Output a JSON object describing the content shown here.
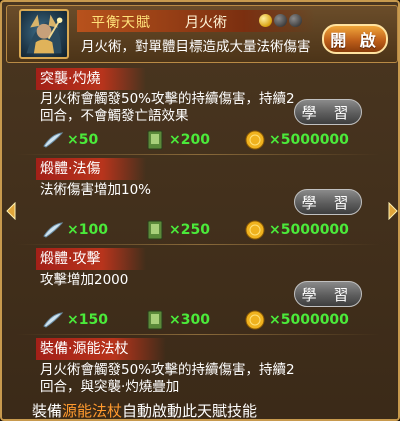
{
  "header": {
    "talent_type": "平衡天賦",
    "talent_name": "月火術",
    "description": "月火術，對單體目標造成大量法術傷害",
    "open_label": "開 啟",
    "level_dots": [
      "gold",
      "gray",
      "gray"
    ]
  },
  "entries": [
    {
      "title": "突襲·灼燒",
      "desc_lines": [
        "月火術會觸發50%攻擊的持續傷害，持續2",
        "回合，不會觸發亡語效果"
      ],
      "learn_label": "學 習",
      "costs": [
        "×50",
        "×200",
        "×5000000"
      ]
    },
    {
      "title": "煅體·法傷",
      "desc_lines": [
        "法術傷害增加10%"
      ],
      "learn_label": "學 習",
      "costs": [
        "×100",
        "×250",
        "×5000000"
      ]
    },
    {
      "title": "煅體·攻擊",
      "desc_lines": [
        "攻擊增加2000"
      ],
      "learn_label": "學 習",
      "costs": [
        "×150",
        "×300",
        "×5000000"
      ]
    },
    {
      "title": "裝備·源能法杖",
      "desc_lines": [
        "月火術會觸發50%攻擊的持續傷害，持續2",
        "回合，與突襲·灼燒疊加"
      ]
    }
  ],
  "footer": {
    "prefix": "裝備",
    "highlight": "源能法杖",
    "suffix": "自動啟動此天賦技能"
  },
  "colors": {
    "accent_orange": "#ff9a2e",
    "cost_green": "#4bea3a",
    "title_red": "#a32018"
  },
  "icons": {
    "cost_1": "feather-icon",
    "cost_2": "skill-book-icon",
    "cost_3": "gold-coin-icon"
  }
}
